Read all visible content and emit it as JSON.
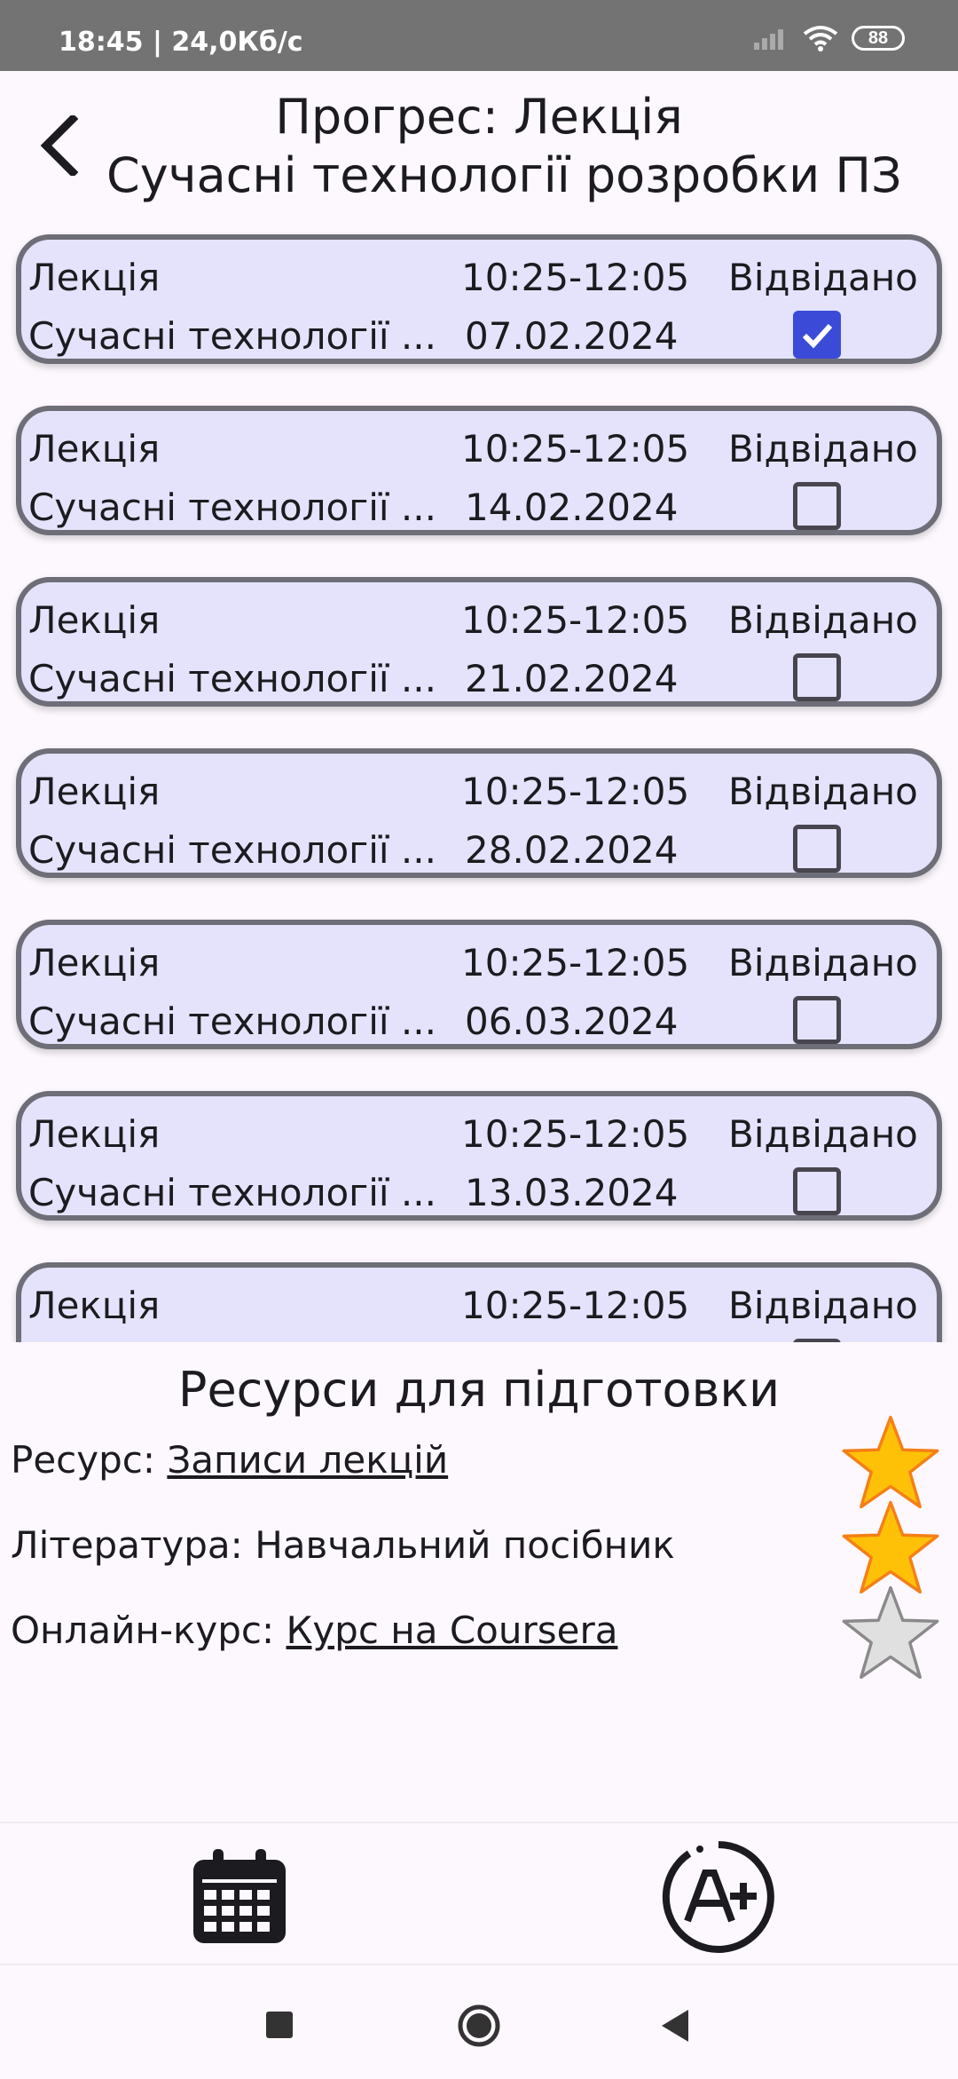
{
  "status_bar": {
    "text": "18:45 | 24,0Кб/с",
    "battery": "88"
  },
  "header": {
    "title_line1": "Прогрес: Лекція",
    "title_line2": "Сучасні технології розробки ПЗ"
  },
  "sessions": [
    {
      "type": "Лекція",
      "time": "10:25-12:05",
      "visited_label": "Відвідано",
      "name": "Сучасні технології ...",
      "date": "07.02.2024",
      "visited": true
    },
    {
      "type": "Лекція",
      "time": "10:25-12:05",
      "visited_label": "Відвідано",
      "name": "Сучасні технології ...",
      "date": "14.02.2024",
      "visited": false
    },
    {
      "type": "Лекція",
      "time": "10:25-12:05",
      "visited_label": "Відвідано",
      "name": "Сучасні технології ...",
      "date": "21.02.2024",
      "visited": false
    },
    {
      "type": "Лекція",
      "time": "10:25-12:05",
      "visited_label": "Відвідано",
      "name": "Сучасні технології ...",
      "date": "28.02.2024",
      "visited": false
    },
    {
      "type": "Лекція",
      "time": "10:25-12:05",
      "visited_label": "Відвідано",
      "name": "Сучасні технології ...",
      "date": "06.03.2024",
      "visited": false
    },
    {
      "type": "Лекція",
      "time": "10:25-12:05",
      "visited_label": "Відвідано",
      "name": "Сучасні технології ...",
      "date": "13.03.2024",
      "visited": false
    },
    {
      "type": "Лекція",
      "time": "10:25-12:05",
      "visited_label": "Відвідано",
      "name": "",
      "date": "",
      "visited": false
    }
  ],
  "resources": {
    "title": "Ресурси для підготовки",
    "items": [
      {
        "label": "Ресурс: ",
        "value": "Записи лекцій",
        "is_link": true,
        "starred": true
      },
      {
        "label": "Література: ",
        "value": "Навчальний посібник",
        "is_link": false,
        "starred": true
      },
      {
        "label": "Онлайн-курс: ",
        "value": "Курс на Coursera",
        "is_link": true,
        "starred": false
      }
    ]
  },
  "icons": {
    "back": "arrow-back-icon",
    "calendar": "calendar-icon",
    "grade": "grade-a-plus-icon",
    "star_filled": "star-filled-icon",
    "star_empty": "star-outline-icon"
  },
  "colors": {
    "card_bg": "#e4e3fb",
    "card_border": "#6e6e78",
    "checkbox_checked": "#3b4bd8",
    "star_filled": "#ffc107",
    "star_empty": "#e0e0e0"
  }
}
